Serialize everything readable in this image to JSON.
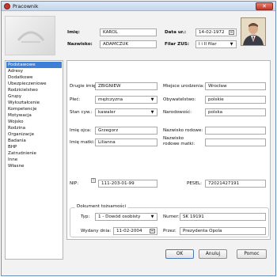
{
  "window": {
    "title": "Pracownik",
    "close_glyph": "✕"
  },
  "header": {
    "imie_label": "Imię:",
    "imie_value": "KAROL",
    "nazwisko_label": "Nazwisko:",
    "nazwisko_value": "ADAMCZUK",
    "data_ur_label": "Data ur.:",
    "data_ur_value": "14-02-1972",
    "filar_label": "Filar ZUS:",
    "filar_value": "I i II filar"
  },
  "nav": {
    "items": [
      "Podstawowe",
      "Adresy",
      "Dodatkowe",
      "Ubezpieczeniowe",
      "Rodzicielstwo",
      "Grupy",
      "Wykształcenie",
      "Kompetencje",
      "Motywacja",
      "Wojsko",
      "Rodzina",
      "Organizacje",
      "Badania",
      "BHP",
      "Zatrudnienie",
      "Inne",
      "Własne"
    ],
    "selected_index": 0
  },
  "form": {
    "drugie_imie_label": "Drugie imię:",
    "drugie_imie_value": "ZBIGNIEW",
    "plec_label": "Płeć:",
    "plec_value": "mężczyzna",
    "stan_label": "Stan cyw.:",
    "stan_value": "kawaler",
    "miejsce_label": "Miejsce urodzenia:",
    "miejsce_value": "Wrocław",
    "obywatelstwo_label": "Obywatelstwo:",
    "obywatelstwo_value": "polskie",
    "narodowosc_label": "Narodowość:",
    "narodowosc_value": "polska",
    "imie_ojca_label": "Imię ojca:",
    "imie_ojca_value": "Grzegorz",
    "imie_matki_label": "Imię matki:",
    "imie_matki_value": "Lilianna",
    "nazwisko_rodowe_label": "Nazwisko rodowe:",
    "nazwisko_rodowe_value": "",
    "nazwisko_matki_label1": "Nazwisko",
    "nazwisko_matki_label2": "rodowe matki:",
    "nazwisko_matki_value": "",
    "nip_label": "NIP:",
    "nip_value": "111-203-01-99",
    "pesel_label": "PESEL:",
    "pesel_value": "72021427191"
  },
  "document": {
    "title": "Dokument tożsamości",
    "typ_label": "Typ:",
    "typ_value": "1 - Dowód osobisty",
    "numer_label": "Numer:",
    "numer_value": "SK 19191",
    "wydany_label": "Wydany dnia:",
    "wydany_value": "11-02-2004",
    "przez_label": "Przez:",
    "przez_value": "Prezydenta Opola"
  },
  "buttons": {
    "ok": "OK",
    "cancel": "Anuluj",
    "help": "Pomoc"
  },
  "colors": {
    "selection": "#3d7fd6",
    "titlebar": "#c3d6ec",
    "close": "#c2362a"
  }
}
